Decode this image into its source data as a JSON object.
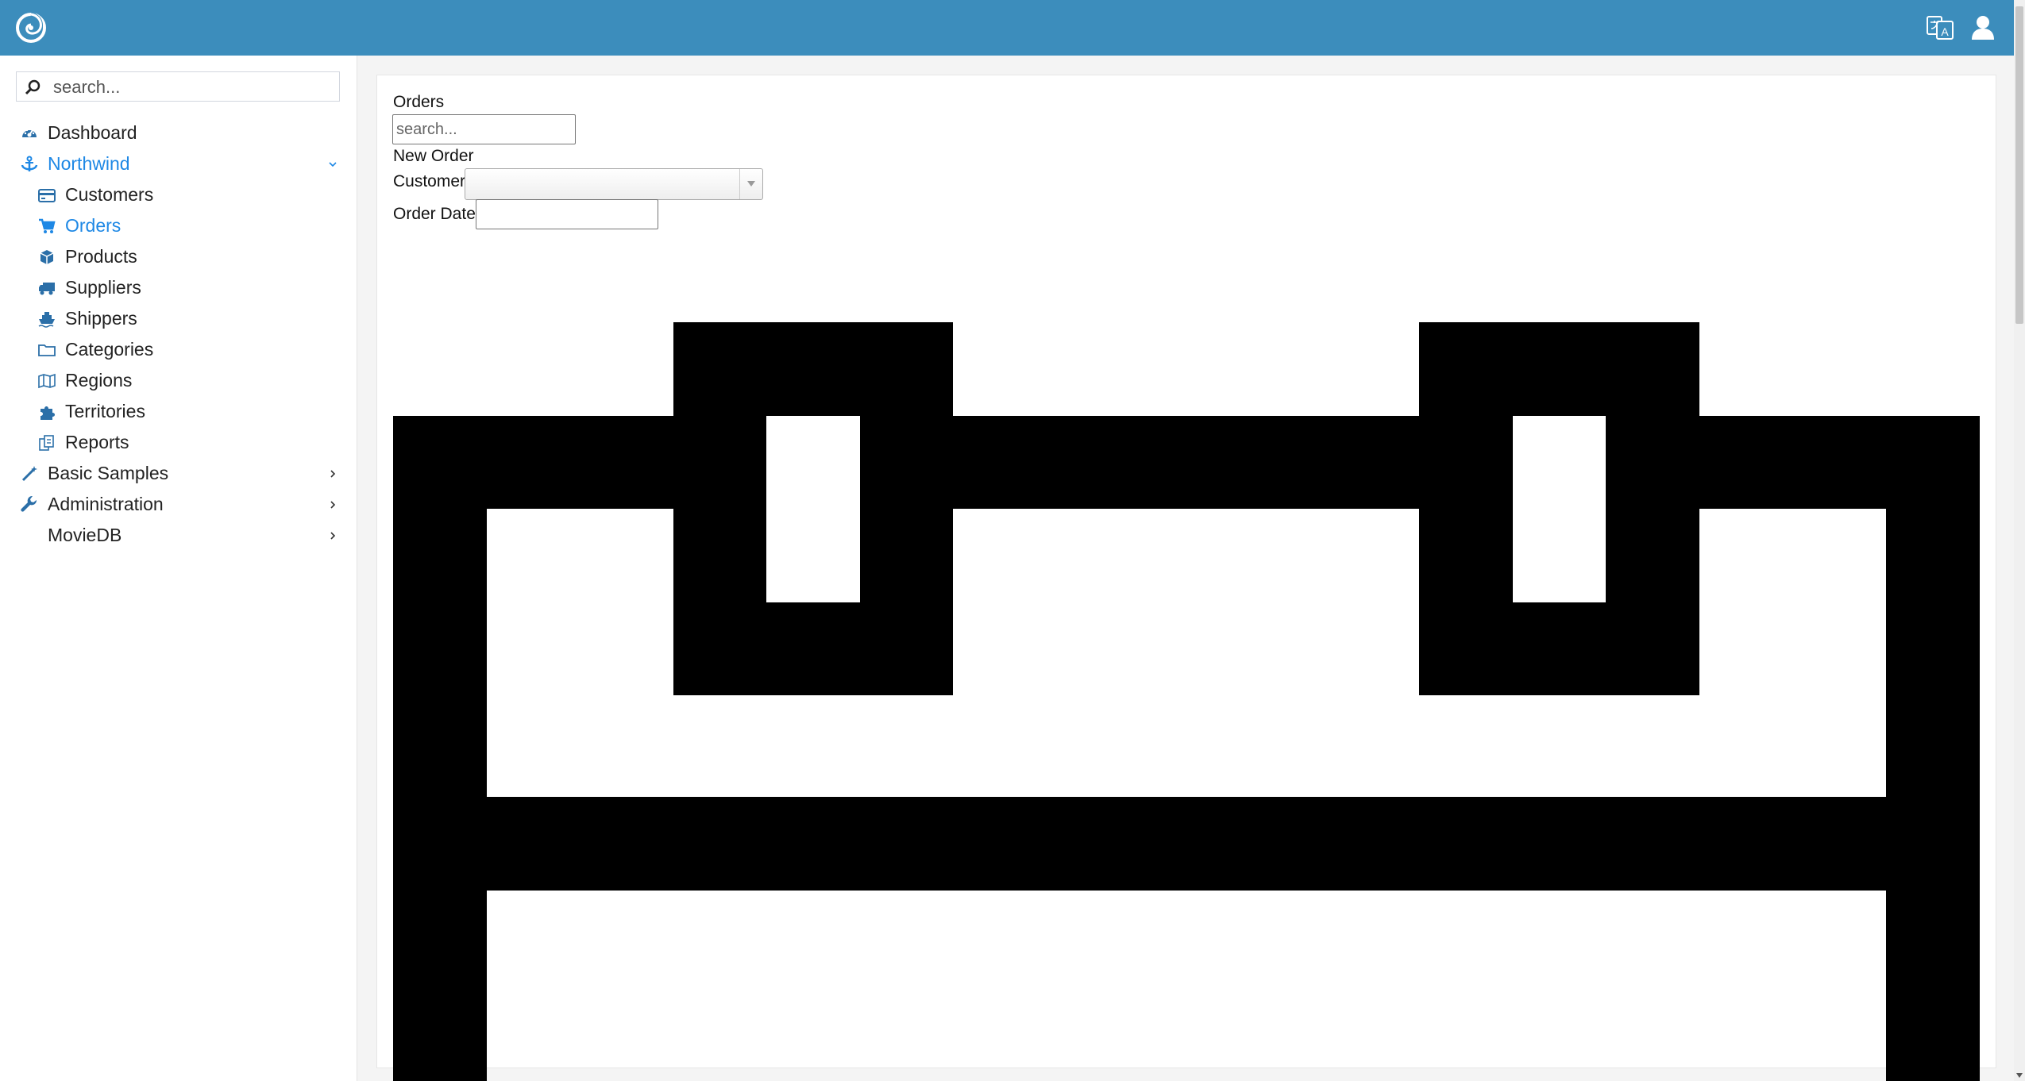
{
  "header": {
    "logo_icon": "serenity-logo-icon",
    "language_icon": "translate-icon",
    "user_icon": "user-icon",
    "bar_color": "#3c8dbc"
  },
  "sidebar": {
    "search_placeholder": "search...",
    "items": [
      {
        "label": "Dashboard",
        "icon": "dashboard-icon"
      },
      {
        "label": "Northwind",
        "icon": "anchor-icon",
        "expanded": true,
        "active": true
      },
      {
        "label": "Customers",
        "icon": "credit-card-icon"
      },
      {
        "label": "Orders",
        "icon": "shopping-cart-icon",
        "active": true
      },
      {
        "label": "Products",
        "icon": "cube-icon"
      },
      {
        "label": "Suppliers",
        "icon": "truck-icon"
      },
      {
        "label": "Shippers",
        "icon": "ship-icon"
      },
      {
        "label": "Categories",
        "icon": "folder-icon"
      },
      {
        "label": "Regions",
        "icon": "map-icon"
      },
      {
        "label": "Territories",
        "icon": "puzzle-icon"
      },
      {
        "label": "Reports",
        "icon": "reports-icon"
      },
      {
        "label": "Basic Samples",
        "icon": "magic-wand-icon",
        "has_children": true
      },
      {
        "label": "Administration",
        "icon": "wrench-icon",
        "has_children": true
      },
      {
        "label": "MovieDB",
        "icon": "",
        "has_children": true
      }
    ],
    "accent_color": "#1e88e5"
  },
  "main": {
    "page_title": "Orders",
    "search_placeholder": "search...",
    "new_order_label": "New Order",
    "customer_label": "Customer",
    "customer_value": "",
    "order_date_label": "Order Date",
    "order_date_value": "",
    "large_icon": "calendar-icon"
  }
}
